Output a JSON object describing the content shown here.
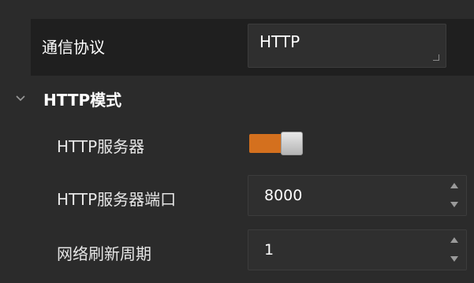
{
  "protocol": {
    "label": "通信协议",
    "value": "HTTP"
  },
  "section": {
    "title": "HTTP模式",
    "expanded": true
  },
  "http_server": {
    "label": "HTTP服务器",
    "enabled": true,
    "accent_color": "#d4701e"
  },
  "http_port": {
    "label": "HTTP服务器端口",
    "value": "8000"
  },
  "refresh_period": {
    "label": "网络刷新周期",
    "value": "1"
  },
  "icons": {
    "section_chevron": "chevron-down-icon",
    "spin_up": "triangle-up-icon",
    "spin_down": "triangle-down-icon"
  }
}
